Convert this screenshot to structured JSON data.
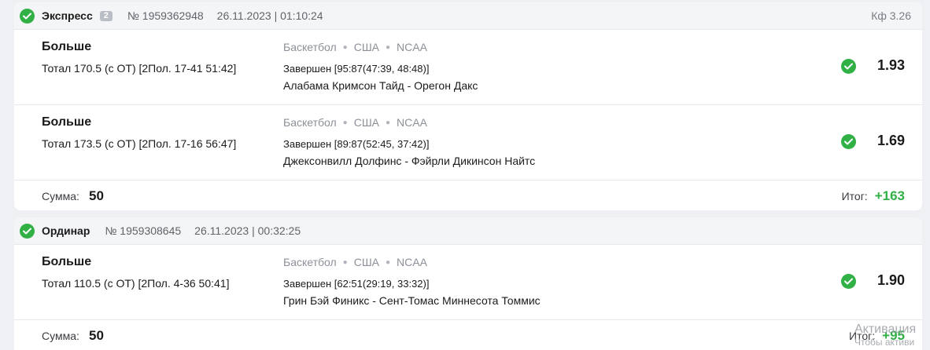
{
  "colors": {
    "win": "#31b046",
    "badge": "#b9bdc6",
    "background": "#eef0f3"
  },
  "bets": [
    {
      "type": "Экспресс",
      "count": "2",
      "number": "№ 1959362948",
      "datetime": "26.11.2023 | 01:10:24",
      "kf": "Кф 3.26",
      "events": [
        {
          "market": "Больше",
          "outcome": "Тотал 170.5 (с ОТ) [2Пол. 17-41 51:42]",
          "sport": "Баскетбол",
          "country": "США",
          "league": "NCAA",
          "status": "Завершен [95:87(47:39, 48:48)]",
          "teams": "Алабама Кримсон Тайд - Орегон Дакс",
          "odd": "1.93"
        },
        {
          "market": "Больше",
          "outcome": "Тотал 173.5 (с ОТ) [2Пол. 17-16 56:47]",
          "sport": "Баскетбол",
          "country": "США",
          "league": "NCAA",
          "status": "Завершен [89:87(52:45, 37:42)]",
          "teams": "Джексонвилл Долфинс - Фэйрли Дикинсон Найтс",
          "odd": "1.69"
        }
      ],
      "sum_label": "Сумма:",
      "sum": "50",
      "itog_label": "Итог:",
      "itog": "+163"
    },
    {
      "type": "Ординар",
      "number": "№ 1959308645",
      "datetime": "26.11.2023 | 00:32:25",
      "events": [
        {
          "market": "Больше",
          "outcome": "Тотал 110.5 (с ОТ) [2Пол. 4-36 50:41]",
          "sport": "Баскетбол",
          "country": "США",
          "league": "NCAA",
          "status": "Завершен [62:51(29:19, 33:32)]",
          "teams": "Грин Бэй Финикс - Сент-Томас Миннесота Томмис",
          "odd": "1.90"
        }
      ],
      "sum_label": "Сумма:",
      "sum": "50",
      "itog_label": "Итог:",
      "itog": "+95"
    }
  ],
  "watermark": {
    "line1": "Активация",
    "line2": "Чтобы активи"
  },
  "icons": {
    "status": "check-circle-icon"
  }
}
